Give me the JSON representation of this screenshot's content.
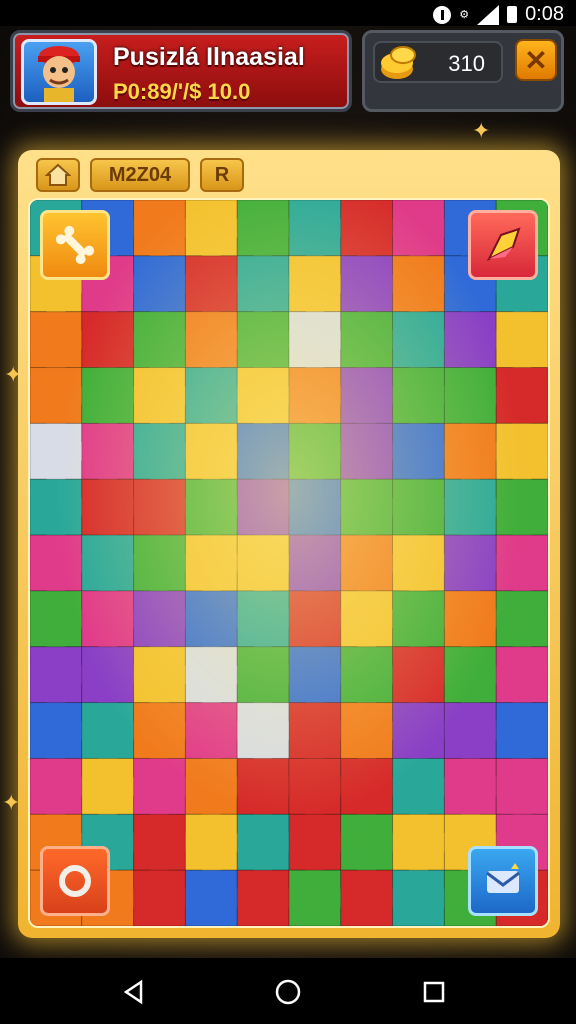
{
  "status_bar": {
    "time": "0:08",
    "icons": [
      "alert-icon",
      "settings-icon",
      "signal-icon",
      "battery-icon"
    ]
  },
  "header": {
    "title": "Pusizlá Ilnaasial",
    "subtitle": "P0:89/'/$ 10.0",
    "avatar": "character-avatar",
    "coins": "310",
    "coin_icon": "gold-coins-icon",
    "close_icon": "close-icon"
  },
  "board": {
    "tabs": {
      "home_icon": "home-icon",
      "name": "M2Z04",
      "r_label": "R"
    },
    "corner_buttons": {
      "top_left": "bone-icon",
      "top_right": "gem-icon",
      "bottom_left": "ring-icon",
      "bottom_right": "mail-icon"
    },
    "grid": {
      "cols": 10,
      "rows": 13
    },
    "colors": {
      "red": "#d62a2a",
      "orange": "#f07a1c",
      "yellow": "#f3c12e",
      "green": "#3fae3a",
      "teal": "#29a89a",
      "blue": "#2f6ad8",
      "purple": "#8a3fc6",
      "pink": "#e03a8a",
      "white": "#d8dce6"
    }
  },
  "nav": {
    "back": "back-icon",
    "home": "home-circle-icon",
    "recent": "recent-apps-icon"
  }
}
